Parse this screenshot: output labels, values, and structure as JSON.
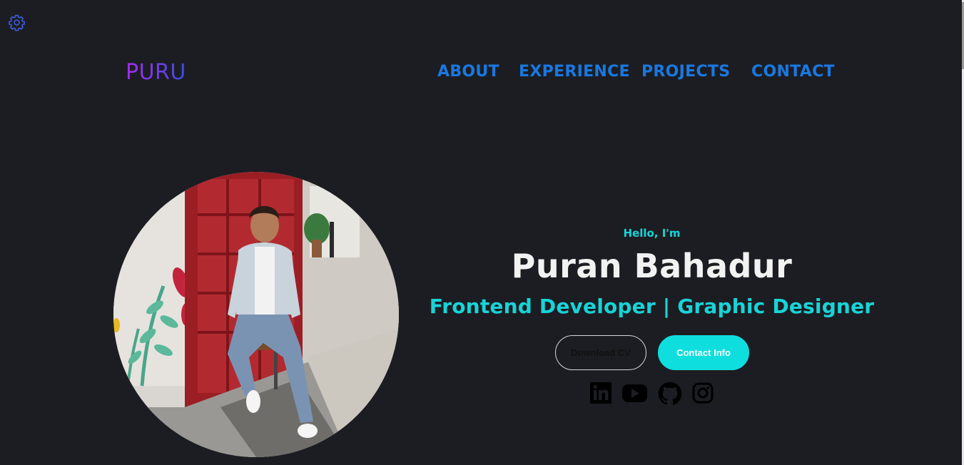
{
  "settings": {
    "icon": "gear-icon",
    "color": "#3b5bdb"
  },
  "logo": {
    "text": "PURU"
  },
  "nav": {
    "items": [
      {
        "label": "ABOUT"
      },
      {
        "label": "EXPERIENCE"
      },
      {
        "label": "PROJECTS"
      },
      {
        "label": "CONTACT"
      }
    ],
    "color": "#1a78e0"
  },
  "hero": {
    "greeting": "Hello, I'm",
    "name": "Puran Bahadur",
    "role": "Frontend Developer | Graphic Designer",
    "buttons": {
      "download_cv": "Download CV",
      "contact_info": "Contact Info"
    },
    "accent": "#17d4d8"
  },
  "social": [
    {
      "icon": "linkedin-icon"
    },
    {
      "icon": "youtube-icon"
    },
    {
      "icon": "github-icon"
    },
    {
      "icon": "instagram-icon"
    }
  ]
}
